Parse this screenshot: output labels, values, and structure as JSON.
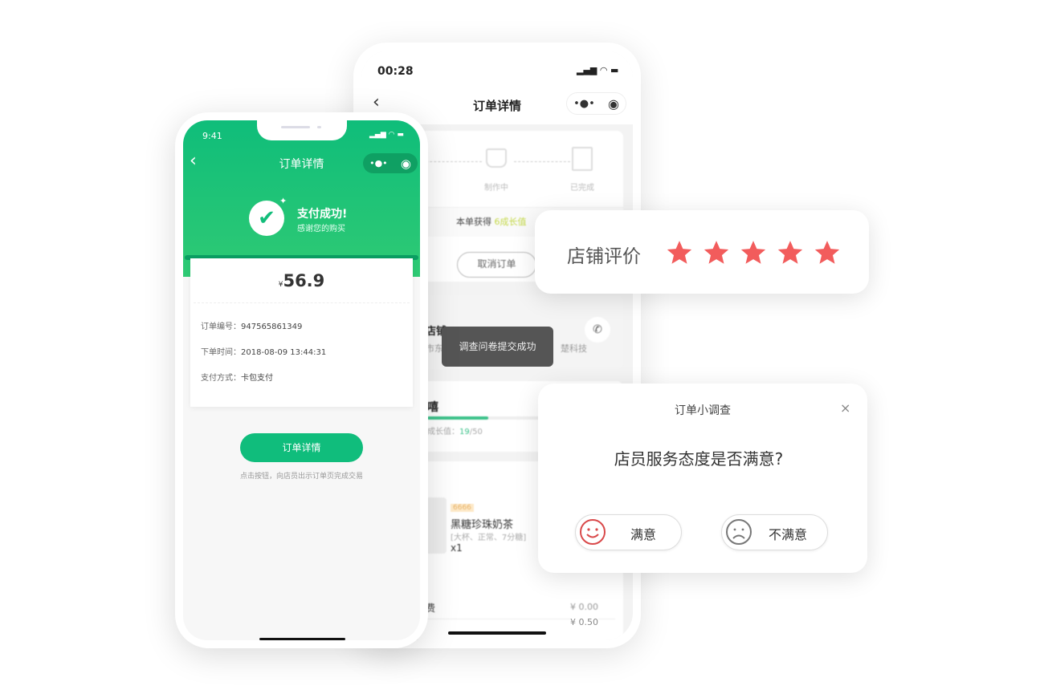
{
  "back_phone": {
    "status_time": "00:28",
    "nav_title": "订单详情",
    "steps": [
      {
        "label": "制作中"
      },
      {
        "label": "已完成"
      }
    ],
    "growth_prefix": "本单获得",
    "growth_value": "6成长值",
    "cancel_button": "取消订单",
    "store_name": "店铺",
    "store_address_left": "市东",
    "store_address_right": "楚科技",
    "toast": "调查问卷提交成功",
    "member_name": "嘻",
    "growth_label": "成长值：",
    "growth_current": "19",
    "growth_total": "/50",
    "growth_progress": 0.38,
    "product": {
      "badge": "6666",
      "name": "黑糖珍珠奶茶",
      "spec": "[大杯、正常、7分糖]",
      "qty": "x1"
    },
    "fee_label": "费",
    "fee_value": "¥ 0.00",
    "fee2_value": "¥ 0.50",
    "accent": "#10bd7c"
  },
  "front_phone": {
    "status_time": "9:41",
    "nav_title": "订单详情",
    "success_title": "支付成功!",
    "success_subtitle": "感谢您的购买",
    "currency": "¥",
    "amount": "56.9",
    "rows": [
      {
        "label": "订单编号：",
        "value": "947565861349"
      },
      {
        "label": "下单时间：",
        "value": "2018-08-09 13:44:31"
      },
      {
        "label": "支付方式：",
        "value": "卡包支付"
      }
    ],
    "detail_button": "订单详情",
    "hint": "点击按钮，向店员出示订单页完成交易",
    "header_color": "#12bd7a"
  },
  "rating_card": {
    "label": "店铺评价",
    "stars": 5,
    "max_stars": 5,
    "star_color": "#f25c5c"
  },
  "survey_card": {
    "title": "订单小调查",
    "question": "店员服务态度是否满意?",
    "options": [
      {
        "label": "满意",
        "icon": "smile-icon"
      },
      {
        "label": "不满意",
        "icon": "frown-icon"
      }
    ]
  }
}
